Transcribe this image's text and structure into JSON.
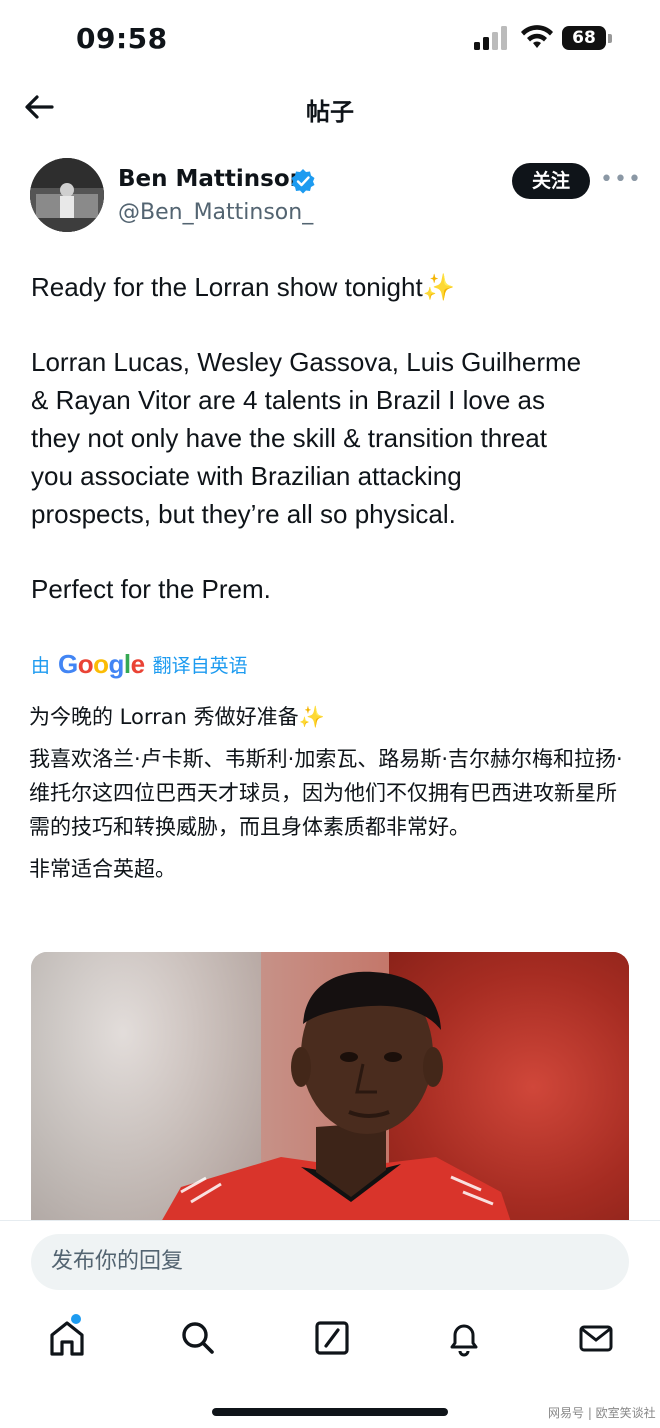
{
  "status_bar": {
    "time": "09:58",
    "battery": "68"
  },
  "header": {
    "title": "帖子"
  },
  "author": {
    "name": "Ben Mattinson",
    "handle": "@Ben_Mattinson_",
    "follow_label": "关注",
    "more": "•••"
  },
  "tweet": {
    "paragraphs": [
      "Ready for the Lorran show tonight✨",
      "Lorran Lucas, Wesley Gassova, Luis Guilherme\n& Rayan Vitor are 4 talents in Brazil I love as\nthey not only have the skill & transition threat\nyou associate with Brazilian attacking\nprospects, but they’re all so physical.",
      "Perfect for the Prem."
    ]
  },
  "translation": {
    "prefix": "由",
    "provider": "Google",
    "suffix": "翻译自英语",
    "paragraphs": [
      "为今晚的 Lorran 秀做好准备✨",
      "我喜欢洛兰·卢卡斯、韦斯利·加索瓦、路易斯·吉尔赫尔梅和拉扬·维托尔这四位巴西天才球员，因为他们不仅拥有巴西进攻新星所需的技巧和转换威胁，而且身体素质都非常好。",
      "非常适合英超。"
    ]
  },
  "reply": {
    "placeholder": "发布你的回复"
  },
  "bottom_nav": {
    "items": [
      "home-icon",
      "search-icon",
      "compose-icon",
      "notifications-icon",
      "messages-icon"
    ]
  },
  "watermark": "网易号 | 欧室笑谈社",
  "colors": {
    "accent": "#1d9bf0",
    "text": "#0f1419",
    "muted": "#536471"
  }
}
